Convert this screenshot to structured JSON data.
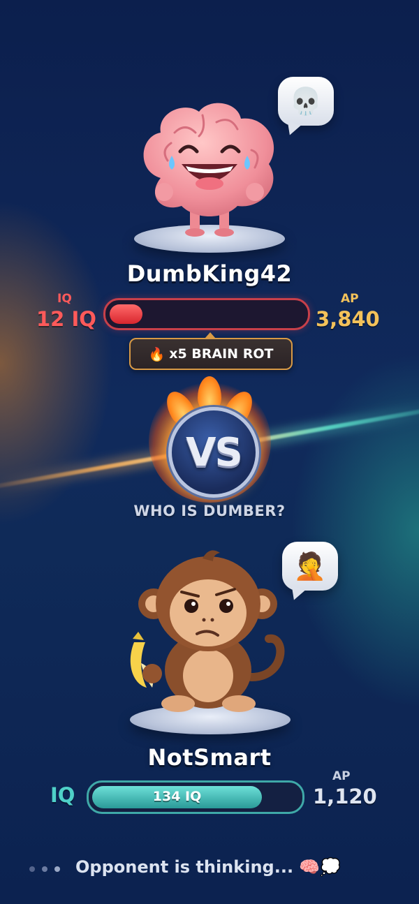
{
  "player_top": {
    "name": "DumbKing42",
    "iq_label": "IQ",
    "iq_value": "12 IQ",
    "iq_fill_fraction": 0.17,
    "ap_label": "AP",
    "ap_value": "3,840",
    "reaction": "💀",
    "avatar": "laughing-brain"
  },
  "streak_badge": {
    "icon": "🔥",
    "text": "x5 BRAIN ROT"
  },
  "versus": {
    "vs_text": "VS",
    "prompt": "WHO IS DUMBER?"
  },
  "player_bottom": {
    "name": "NotSmart",
    "iq_label": "IQ",
    "iq_bar_text": "134 IQ",
    "iq_fill_fraction": 0.82,
    "ap_label": "AP",
    "ap_value": "1,120",
    "reaction": "🤦",
    "avatar": "confused-monkey-with-banana"
  },
  "status": {
    "text": "Opponent is thinking... 🧠💭"
  },
  "colors": {
    "red": "#ff5a5a",
    "gold": "#f3c25a",
    "teal": "#4fd0c8",
    "background": "#0e2350"
  }
}
